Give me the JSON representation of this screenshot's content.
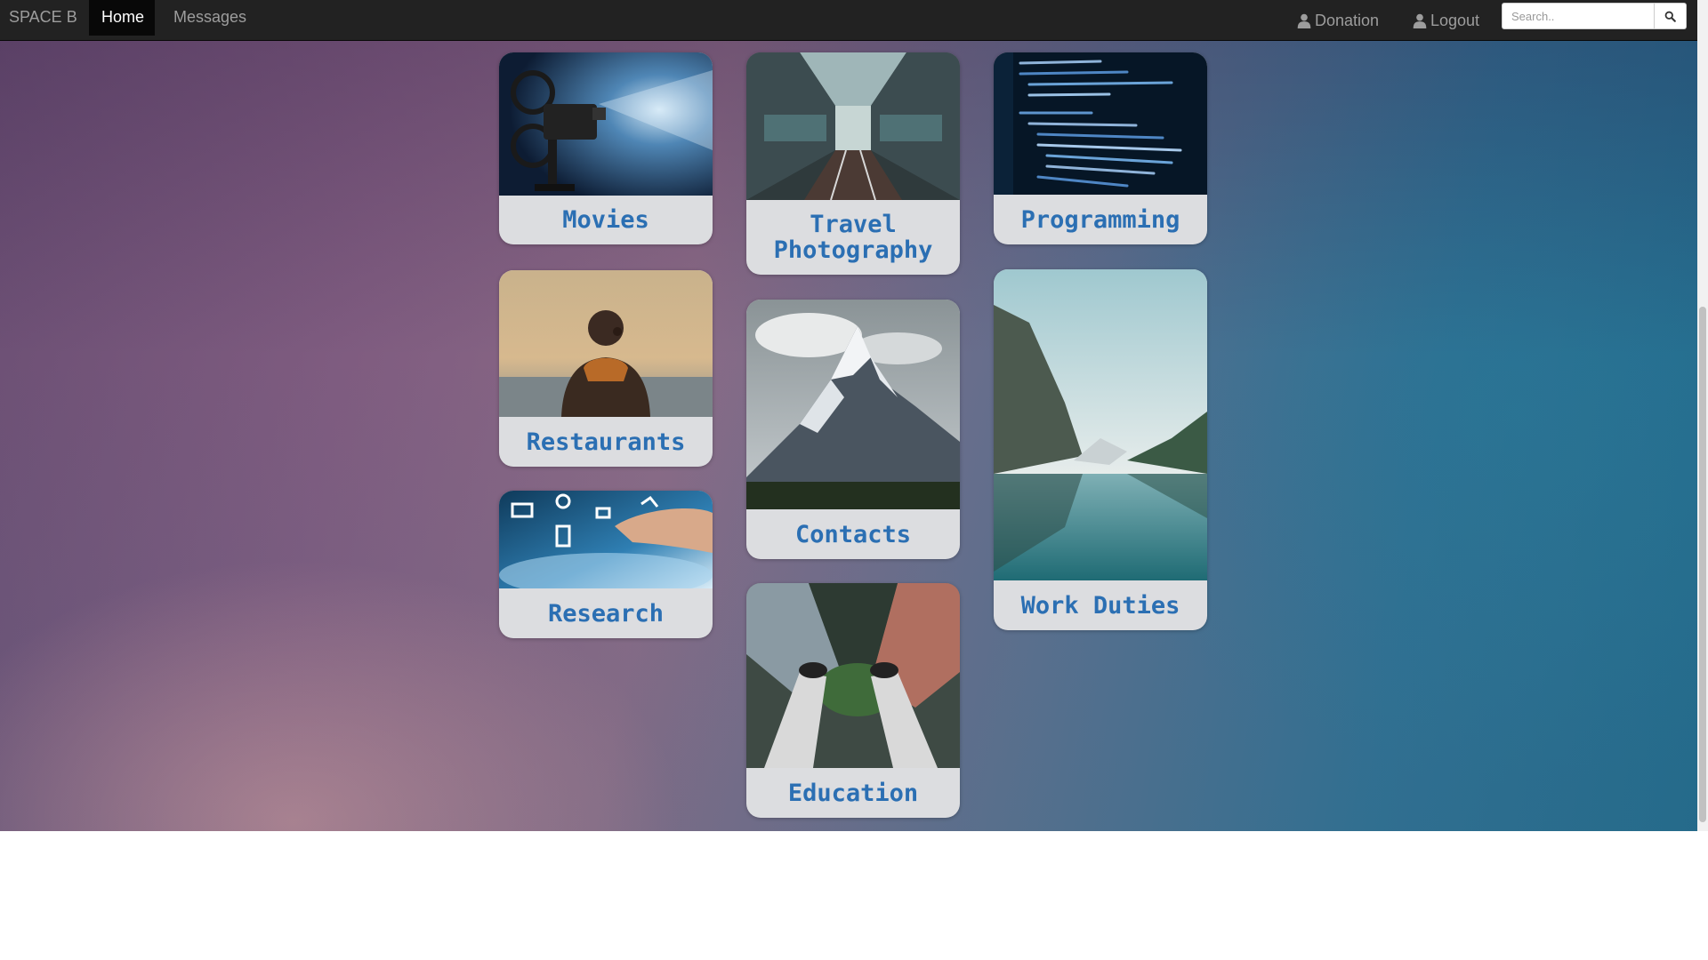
{
  "navbar": {
    "brand": "SPACE B",
    "home_label": "Home",
    "messages_label": "Messages",
    "donation_label": "Donation",
    "logout_label": "Logout",
    "search_placeholder": "Search..",
    "colors": {
      "bar": "#222222",
      "active": "#080808",
      "text": "#9d9d9d"
    }
  },
  "icons": {
    "donation": "user-icon",
    "logout": "user-icon",
    "search_button": "search-icon"
  },
  "cards": {
    "movies": "Movies",
    "travel_photography": [
      "Travel",
      "Photography"
    ],
    "programming": "Programming",
    "restaurants": "Restaurants",
    "contacts": "Contacts",
    "work_duties": "Work Duties",
    "research": "Research",
    "education": "Education"
  },
  "colors": {
    "card_label": "#2b6fb3",
    "card_bg": "#dcdde0"
  }
}
